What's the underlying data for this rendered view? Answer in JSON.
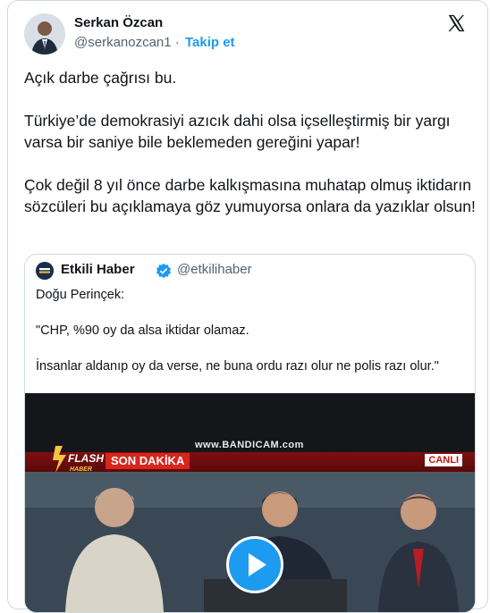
{
  "author": {
    "name": "Serkan Özcan",
    "handle": "@serkanozcan1",
    "separator": "·",
    "follow_label": "Takip et"
  },
  "icons": {
    "brand": "x-logo-icon",
    "verified": "verified-badge-icon",
    "play": "play-icon"
  },
  "tweet": {
    "paragraphs": [
      "Açık darbe çağrısı bu.",
      "Türkiye’de demokrasiyi azıcık dahi olsa içselleştirmiş bir yargı varsa bir saniye bile beklemeden gereğini yapar!",
      "Çok değil 8 yıl önce darbe kalkışmasına muhatap olmuş iktidarın sözcüleri bu açıklamaya göz yumuyorsa onlara da yazıklar olsun!"
    ]
  },
  "quote": {
    "name": "Etkili Haber",
    "handle": "@etkilihaber",
    "avatar_text": "ETKİLİ HABER",
    "paragraphs": [
      "Doğu Perinçek:",
      "\"CHP, %90 oy da alsa iktidar olamaz.",
      "İnsanlar aldanıp oy da verse, ne buna ordu razı olur ne polis razı olur.\""
    ],
    "video": {
      "watermark": "www.BANDICAM.com",
      "channel_logo": "FLASH HABER",
      "banner": "SON DAKİKA",
      "live_badge": "CANLI"
    }
  },
  "colors": {
    "accent": "#1d9bf0",
    "text": "#0f1419",
    "muted": "#536471",
    "border": "#cfd9de",
    "breaking_red": "#d8251d"
  }
}
